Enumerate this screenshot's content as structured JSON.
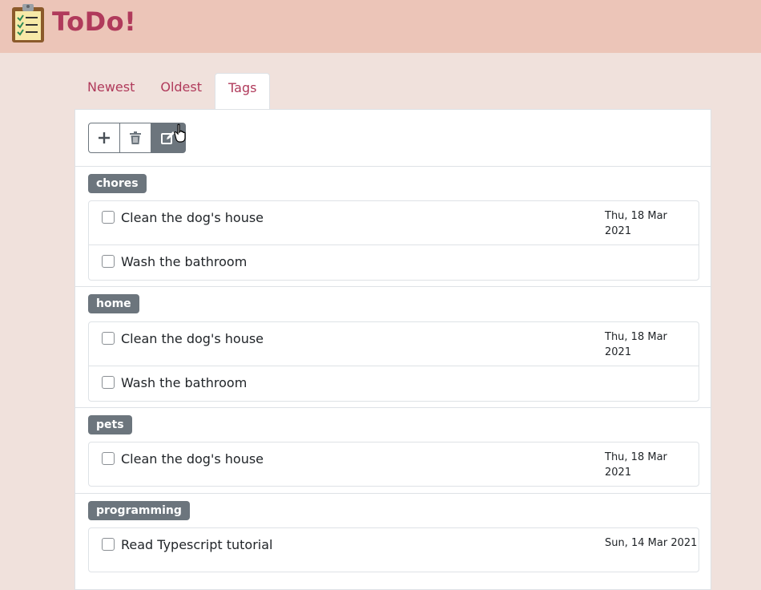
{
  "app": {
    "title": "ToDo!",
    "logo_icon": "clipboard-checklist-icon"
  },
  "tabs": [
    {
      "label": "Newest",
      "active": false
    },
    {
      "label": "Oldest",
      "active": false
    },
    {
      "label": "Tags",
      "active": true
    }
  ],
  "toolbar": {
    "add_icon": "plus-icon",
    "delete_icon": "trash-icon",
    "edit_icon": "edit-icon"
  },
  "groups": [
    {
      "tag": "chores",
      "items": [
        {
          "text": "Clean the dog's house",
          "date": "Thu, 18 Mar 2021"
        },
        {
          "text": "Wash the bathroom",
          "date": ""
        }
      ]
    },
    {
      "tag": "home",
      "items": [
        {
          "text": "Clean the dog's house",
          "date": "Thu, 18 Mar 2021"
        },
        {
          "text": "Wash the bathroom",
          "date": ""
        }
      ]
    },
    {
      "tag": "pets",
      "items": [
        {
          "text": "Clean the dog's house",
          "date": "Thu, 18 Mar 2021"
        }
      ]
    },
    {
      "tag": "programming",
      "items": [
        {
          "text": "Read Typescript tutorial",
          "date": "Sun, 14 Mar 2021"
        }
      ]
    }
  ],
  "colors": {
    "brand": "#b03a5b",
    "header_bg": "#ecc5b8",
    "page_bg": "#f0e1dc",
    "badge_bg": "#6c757d"
  }
}
